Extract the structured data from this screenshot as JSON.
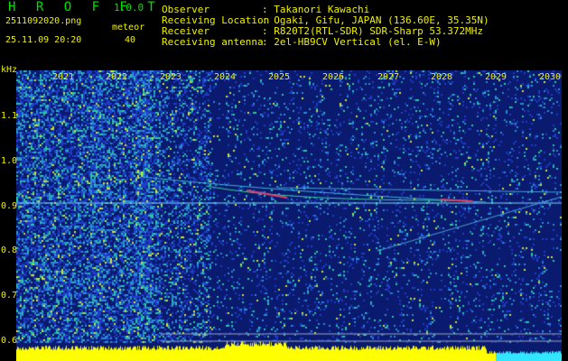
{
  "header": {
    "title": "H R O F F T",
    "version": "1.0.0",
    "filename": "2511092020.png",
    "datetime": "25.11.09 20:20",
    "meteor_label": "meteor",
    "meteor_count": "40",
    "info": [
      {
        "label": "Observer",
        "value": ": Takanori Kawachi"
      },
      {
        "label": "Receiving Location",
        "value": ": Ogaki, Gifu, JAPAN (136.60E, 35.35N)"
      },
      {
        "label": "Receiver",
        "value": ": R820T2(RTL-SDR) SDR-Sharp 53.372MHz"
      },
      {
        "label": "Receiving antenna",
        "value": ": 2el-HB9CV Vertical (el. E-W)"
      }
    ]
  },
  "axis": {
    "unit": "kHz",
    "y_ticks": [
      "1.1",
      "1.0",
      "0.9",
      "0.8",
      "0.7",
      "0.6"
    ],
    "x_ticks": [
      "2021",
      "2022",
      "2023",
      "2024",
      "2025",
      "2026",
      "2027",
      "2028",
      "2029",
      "2030"
    ]
  },
  "colors": {
    "background": "#000000",
    "label_green": "#00e000",
    "label_yellow": "#f0f000",
    "spectrogram_base": "#0a1a6e",
    "noise_bar": "#ffff00"
  }
}
